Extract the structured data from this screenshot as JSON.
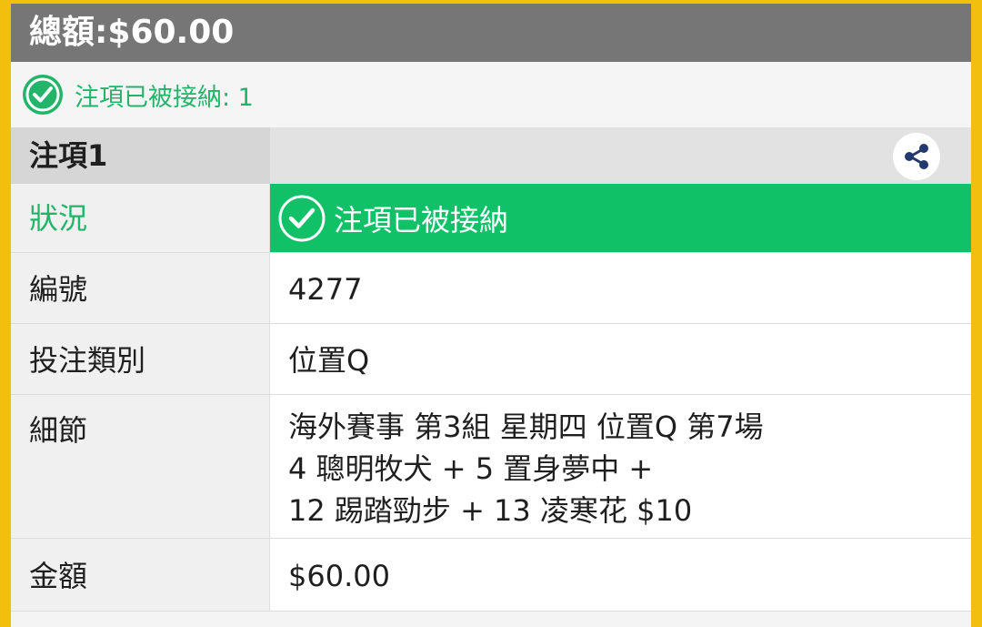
{
  "total": {
    "text": "總額:$60.00"
  },
  "accepted_summary": {
    "text": "注項已被接納: 1",
    "icon": "check-circle-icon"
  },
  "bet": {
    "title": "注項1",
    "share_icon": "share-icon",
    "rows": {
      "status": {
        "label": "狀況",
        "value": "注項已被接納"
      },
      "id": {
        "label": "編號",
        "value": "4277"
      },
      "type": {
        "label": "投注類別",
        "value": "位置Q"
      },
      "detail": {
        "label": "細節",
        "lines": [
          "海外賽事 第3組 星期四 位置Q 第7場",
          "4 聰明牧犬 + 5 置身夢中 +",
          "12 踢踏勁步 + 13 凌寒花 $10"
        ]
      },
      "amount": {
        "label": "金額",
        "value": "$60.00"
      }
    }
  },
  "colors": {
    "accent_green": "#10c167",
    "text_green": "#22b56a",
    "header_gray": "#767676",
    "frame_yellow": "#f2bf0f"
  }
}
